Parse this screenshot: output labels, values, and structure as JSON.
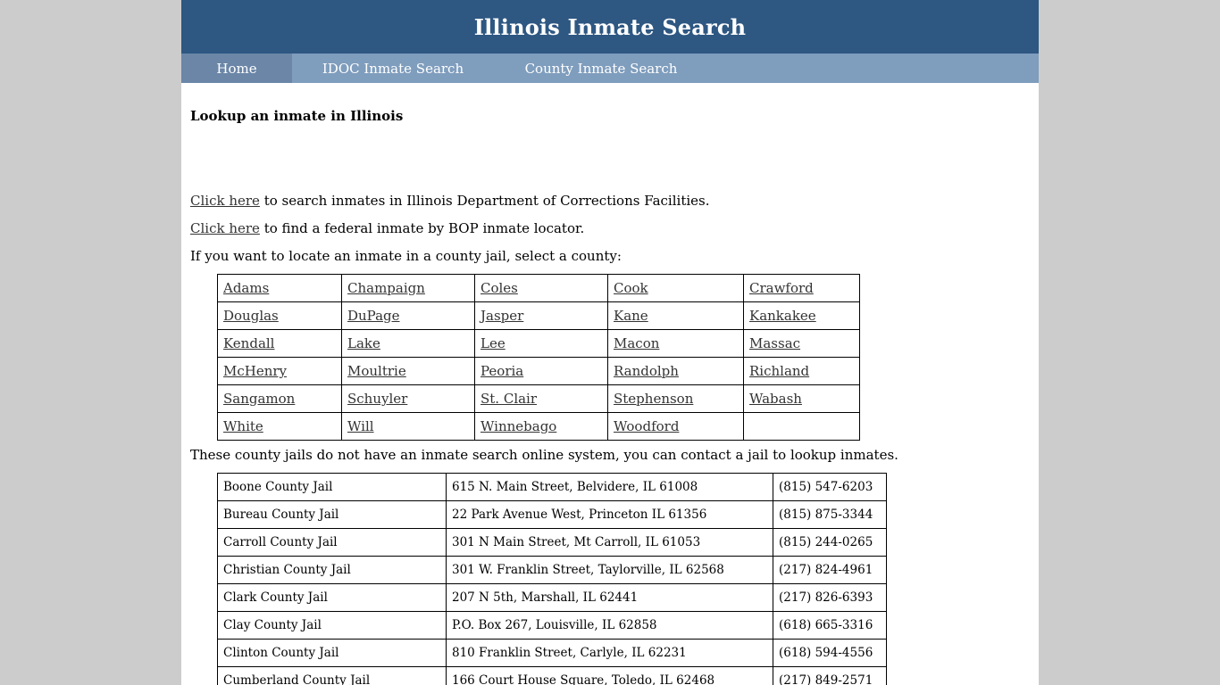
{
  "header": {
    "title": "Illinois Inmate Search"
  },
  "nav": [
    {
      "label": "Home"
    },
    {
      "label": "IDOC Inmate Search"
    },
    {
      "label": "County Inmate Search"
    }
  ],
  "main": {
    "heading": "Lookup an inmate in Illinois",
    "idoc_link": "Click here",
    "idoc_text": " to search inmates in Illinois Department of Corrections Facilities.",
    "bop_link": "Click here",
    "bop_text": " to find a federal inmate by BOP inmate locator.",
    "county_intro": "If you want to locate an inmate in a county jail, select a county:",
    "counties": [
      [
        "Adams",
        "Champaign",
        "Coles",
        "Cook",
        "Crawford"
      ],
      [
        "Douglas",
        "DuPage",
        "Jasper",
        "Kane",
        "Kankakee"
      ],
      [
        "Kendall",
        "Lake",
        "Lee",
        "Macon",
        "Massac"
      ],
      [
        "McHenry",
        "Moultrie",
        "Peoria",
        "Randolph",
        "Richland"
      ],
      [
        "Sangamon",
        "Schuyler",
        "St. Clair",
        "Stephenson",
        "Wabash"
      ],
      [
        "White",
        "Will",
        "Winnebago",
        "Woodford",
        ""
      ]
    ],
    "nojail_intro": "These county jails do not have an inmate search online system, you can contact a jail to lookup inmates.",
    "jails": [
      [
        "Boone County Jail",
        "615 N. Main Street, Belvidere, IL 61008",
        "(815) 547-6203"
      ],
      [
        "Bureau County Jail",
        "22 Park Avenue West, Princeton IL 61356",
        "(815) 875-3344"
      ],
      [
        "Carroll County Jail",
        "301 N Main Street, Mt Carroll, IL 61053",
        "(815) 244-0265"
      ],
      [
        "Christian County Jail",
        "301 W. Franklin Street, Taylorville, IL 62568",
        "(217) 824-4961"
      ],
      [
        "Clark County Jail",
        "207 N 5th, Marshall, IL 62441",
        "(217) 826-6393"
      ],
      [
        "Clay County Jail",
        "P.O. Box 267, Louisville, IL 62858",
        "(618) 665-3316"
      ],
      [
        "Clinton County Jail",
        "810 Franklin Street, Carlyle, IL 62231",
        "(618) 594-4556"
      ],
      [
        "Cumberland County Jail",
        "166 Court House Square, Toledo, IL 62468",
        "(217) 849-2571"
      ]
    ]
  }
}
